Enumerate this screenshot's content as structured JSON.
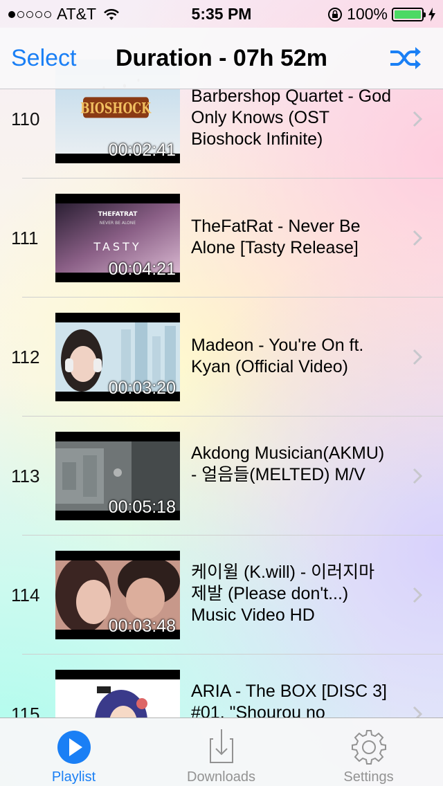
{
  "status_bar": {
    "carrier": "AT&T",
    "time": "5:35 PM",
    "battery": "100%",
    "signal_bars_filled": 1,
    "signal_bars_total": 5
  },
  "nav": {
    "select_label": "Select",
    "title": "Duration - 07h 52m",
    "shuffle_icon": "shuffle-icon",
    "accent_color": "#1a7ff5"
  },
  "rows": [
    {
      "number": "110",
      "duration": "00:02:41",
      "title": "Barbershop Quartet - God Only Knows (OST Bioshock Infinite)"
    },
    {
      "number": "111",
      "duration": "00:04:21",
      "title": "TheFatRat - Never Be Alone [Tasty Release]"
    },
    {
      "number": "112",
      "duration": "00:03:20",
      "title": "Madeon - You're On ft. Kyan (Official Video)"
    },
    {
      "number": "113",
      "duration": "00:05:18",
      "title": "Akdong Musician(AKMU) - 얼음들(MELTED) M/V"
    },
    {
      "number": "114",
      "duration": "00:03:48",
      "title": "케이윌 (K.will) - 이러지마 제발 (Please don't...) Music Video HD"
    },
    {
      "number": "115",
      "duration": "",
      "title": "ARIA - The BOX [DISC 3] #01. \"Shourou no"
    }
  ],
  "thumb_text": {
    "bioshock": "BIOSHOCK",
    "fatrat": "THEFATRAT",
    "fatrat_sub": "NEVER BE ALONE",
    "tasty": "TASTY"
  },
  "tabs": [
    {
      "label": "Playlist",
      "icon": "play-circle-icon",
      "active": true
    },
    {
      "label": "Downloads",
      "icon": "download-tray-icon",
      "active": false
    },
    {
      "label": "Settings",
      "icon": "gear-icon",
      "active": false
    }
  ]
}
